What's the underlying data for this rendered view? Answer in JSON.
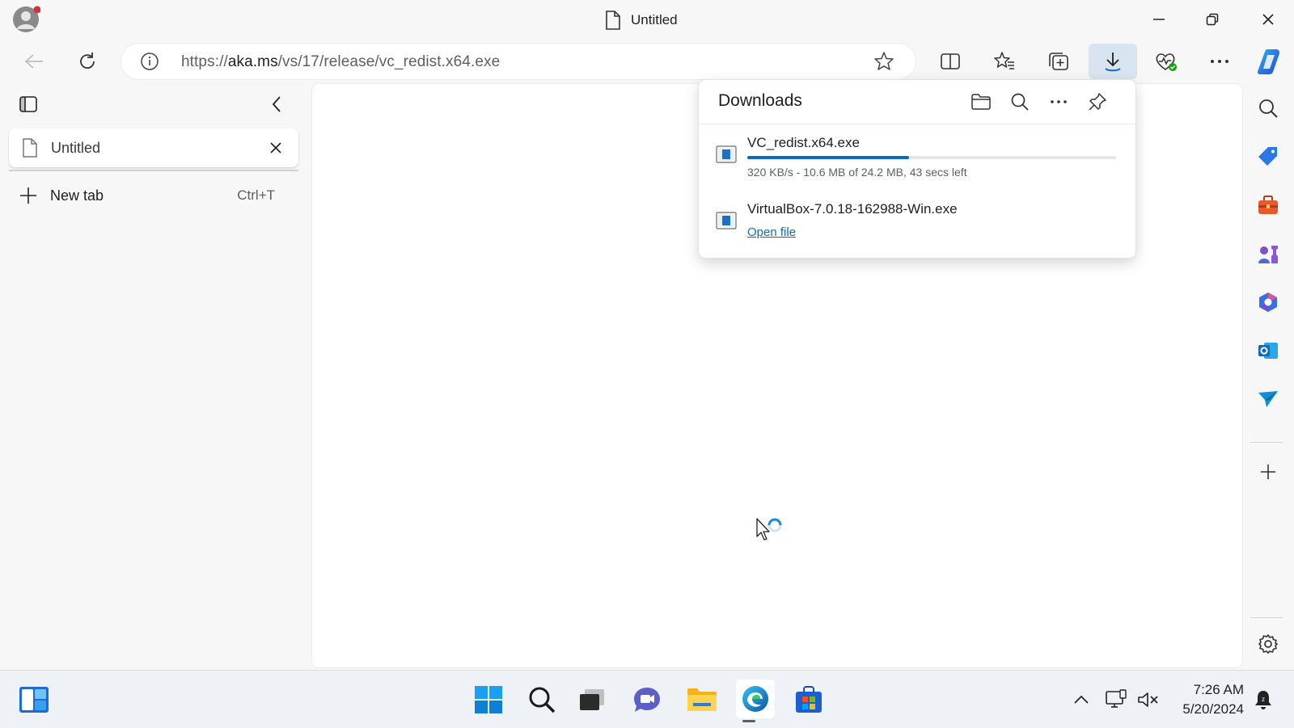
{
  "window": {
    "title": "Untitled",
    "minimize_icon": "minimize-icon",
    "restore_icon": "restore-icon",
    "close_icon": "close-icon"
  },
  "navbar": {
    "url_prefix": "https://",
    "url_host": "aka.ms",
    "url_path": "/vs/17/release/vc_redist.x64.exe",
    "icons": [
      "back-icon",
      "refresh-icon",
      "site-info-icon",
      "favorite-star-icon",
      "split-screen-icon",
      "favorites-icon",
      "collections-icon",
      "downloads-icon",
      "browser-essentials-icon",
      "more-icon",
      "copilot-icon"
    ]
  },
  "tabs": {
    "items": [
      {
        "label": "Untitled"
      }
    ],
    "new_tab_label": "New tab",
    "new_tab_shortcut": "Ctrl+T"
  },
  "downloads": {
    "title": "Downloads",
    "items": [
      {
        "name": "VC_redist.x64.exe",
        "status": "320 KB/s - 10.6 MB of 24.2 MB, 43 secs left",
        "progress": 0.438
      },
      {
        "name": "VirtualBox-7.0.18-162988-Win.exe",
        "action": "Open file"
      }
    ]
  },
  "right_sidebar": {
    "icons": [
      "search-icon",
      "shopping-tag-icon",
      "tools-icon",
      "games-icon",
      "microsoft365-icon",
      "outlook-icon",
      "send-icon",
      "add-icon",
      "settings-icon"
    ]
  },
  "taskbar": {
    "time": "7:26 AM",
    "date": "5/20/2024"
  },
  "colors": {
    "accent": "#0f6cbd",
    "progress_track": "#e6e6e6",
    "active_button": "#d8e4ef"
  }
}
